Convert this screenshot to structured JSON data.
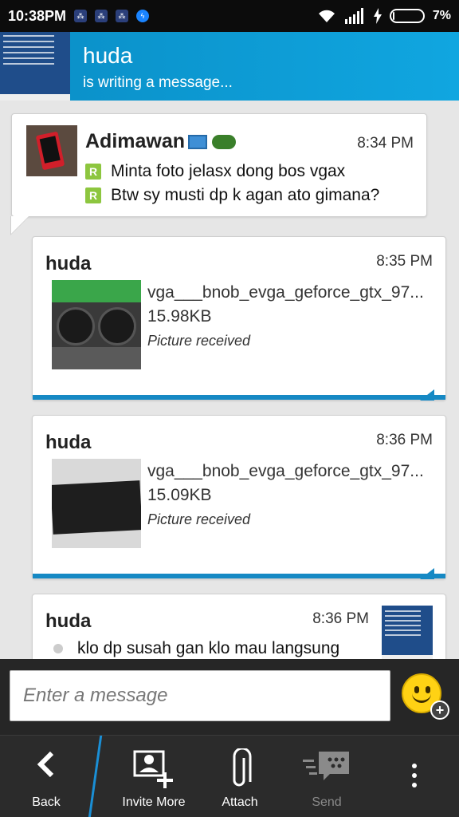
{
  "status_bar": {
    "time": "10:38PM",
    "battery": "7%",
    "battery_level": 0.07,
    "icons": [
      "bbm-icon",
      "bbm-icon",
      "bbm-icon",
      "messenger-icon",
      "wifi-icon",
      "signal-icon",
      "charging-icon",
      "battery-icon"
    ]
  },
  "header": {
    "title": "huda",
    "subtitle": "is writing a message..."
  },
  "messages": [
    {
      "sender": "Adimawan",
      "time": "8:34 PM",
      "lines": [
        "Minta foto jelasx dong bos vgax",
        "Btw sy musti dp k agan ato gimana?"
      ],
      "status_icon": "read-r-icon"
    },
    {
      "sender": "huda",
      "time": "8:35 PM",
      "file_name": "vga___bnob_evga_geforce_gtx_97...",
      "file_size": "15.98KB",
      "file_status": "Picture received"
    },
    {
      "sender": "huda",
      "time": "8:36 PM",
      "file_name": "vga___bnob_evga_geforce_gtx_97...",
      "file_size": "15.09KB",
      "file_status": "Picture received"
    },
    {
      "sender": "huda",
      "time": "8:36 PM",
      "text": "klo dp susah gan klo mau langsung"
    }
  ],
  "compose": {
    "placeholder": "Enter a message"
  },
  "toolbar": {
    "back": "Back",
    "invite_more": "Invite More",
    "attach": "Attach",
    "send": "Send"
  },
  "colors": {
    "header": "#10a6e0",
    "accent_bar": "#1689c4",
    "read_badge": "#8dc63f"
  }
}
